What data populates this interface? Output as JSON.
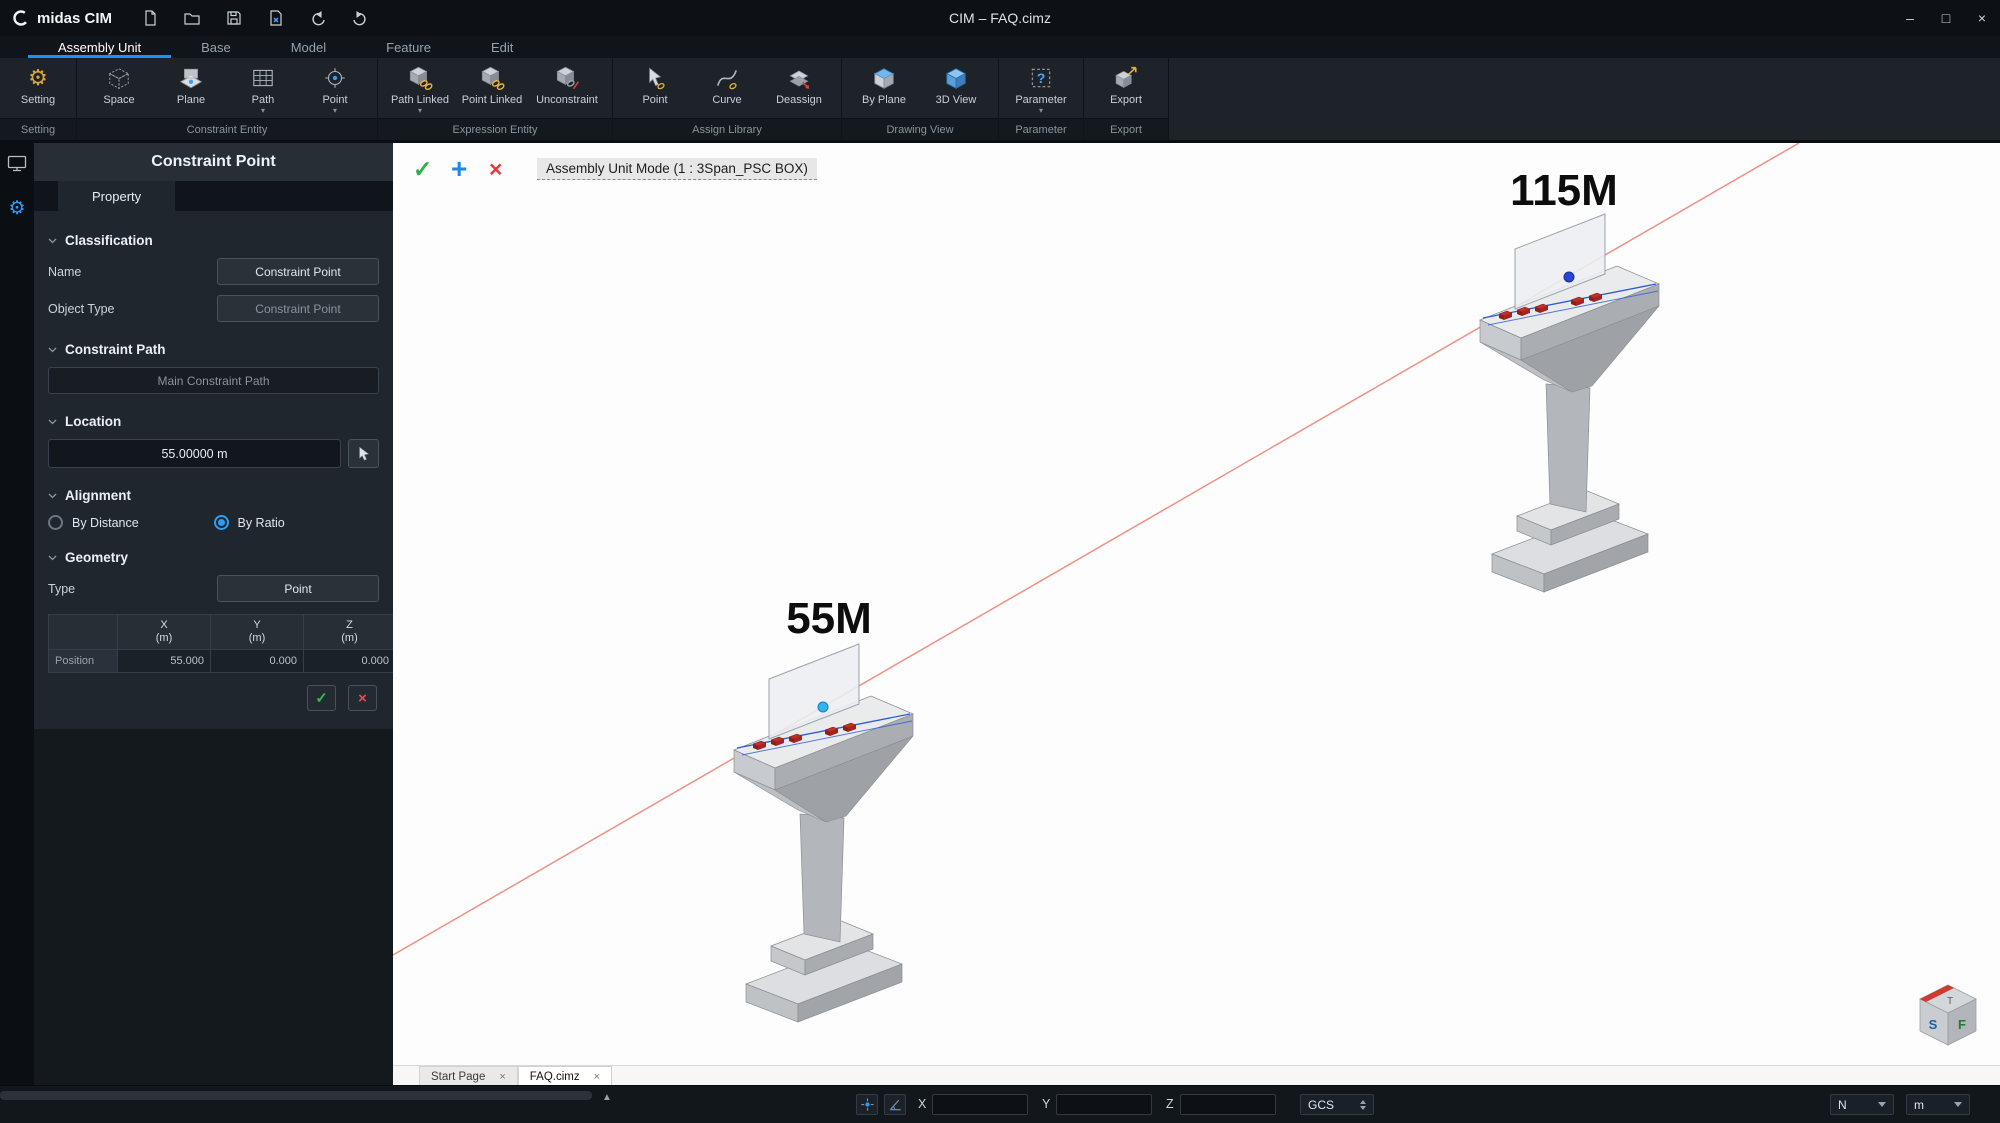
{
  "glyphs": {
    "check": "✓",
    "plus": "+",
    "cross": "×",
    "dropdown": "▾",
    "minimize": "–",
    "maximize": "□",
    "close": "×",
    "gear": "⚙",
    "scroll_up": "▲"
  },
  "titlebar": {
    "app": "midas CIM",
    "title": "CIM – FAQ.cimz"
  },
  "menu": {
    "tabs": [
      "Assembly Unit",
      "Base",
      "Model",
      "Feature",
      "Edit"
    ]
  },
  "ribbon": {
    "groups": [
      {
        "label": "Setting",
        "buttons": [
          {
            "label": "Setting"
          }
        ]
      },
      {
        "label": "Constraint Entity",
        "buttons": [
          {
            "label": "Space"
          },
          {
            "label": "Plane"
          },
          {
            "label": "Path"
          },
          {
            "label": "Point"
          }
        ]
      },
      {
        "label": "Expression Entity",
        "buttons": [
          {
            "label": "Path Linked"
          },
          {
            "label": "Point Linked"
          },
          {
            "label": "Unconstraint"
          }
        ]
      },
      {
        "label": "Assign Library",
        "buttons": [
          {
            "label": "Point"
          },
          {
            "label": "Curve"
          },
          {
            "label": "Deassign"
          }
        ]
      },
      {
        "label": "Drawing View",
        "buttons": [
          {
            "label": "By Plane"
          },
          {
            "label": "3D View"
          }
        ]
      },
      {
        "label": "Parameter",
        "buttons": [
          {
            "label": "Parameter"
          }
        ]
      },
      {
        "label": "Export",
        "buttons": [
          {
            "label": "Export"
          }
        ]
      }
    ]
  },
  "panel": {
    "title": "Constraint Point",
    "tab": "Property",
    "classification": {
      "header": "Classification",
      "name_label": "Name",
      "name_value": "Constraint Point",
      "object_type_label": "Object Type",
      "object_type_value": "Constraint Point"
    },
    "constraint_path": {
      "header": "Constraint Path",
      "placeholder": "Main Constraint Path"
    },
    "location": {
      "header": "Location",
      "value": "55.00000 m"
    },
    "alignment": {
      "header": "Alignment",
      "options": [
        {
          "label": "By Distance",
          "selected": false
        },
        {
          "label": "By Ratio",
          "selected": true
        }
      ]
    },
    "geometry": {
      "header": "Geometry",
      "type_label": "Type",
      "type_value": "Point",
      "table": {
        "unit": "(m)",
        "columns": [
          "X",
          "Y",
          "Z"
        ],
        "row_label": "Position",
        "values": [
          "55.000",
          "0.000",
          "0.000"
        ]
      }
    }
  },
  "viewport": {
    "mode_label": "Assembly Unit Mode (1 : 3Span_PSC BOX)",
    "pier_near_label": "55M",
    "pier_far_label": "115M",
    "view_cube": {
      "top": "T",
      "left": "S",
      "right": "F"
    }
  },
  "doc_tabs": [
    {
      "label": "Start Page",
      "active": false
    },
    {
      "label": "FAQ.cimz",
      "active": true
    }
  ],
  "statusbar": {
    "x_label": "X",
    "y_label": "Y",
    "z_label": "Z",
    "coord_system": "GCS",
    "north_label": "N",
    "unit_label": "m"
  }
}
